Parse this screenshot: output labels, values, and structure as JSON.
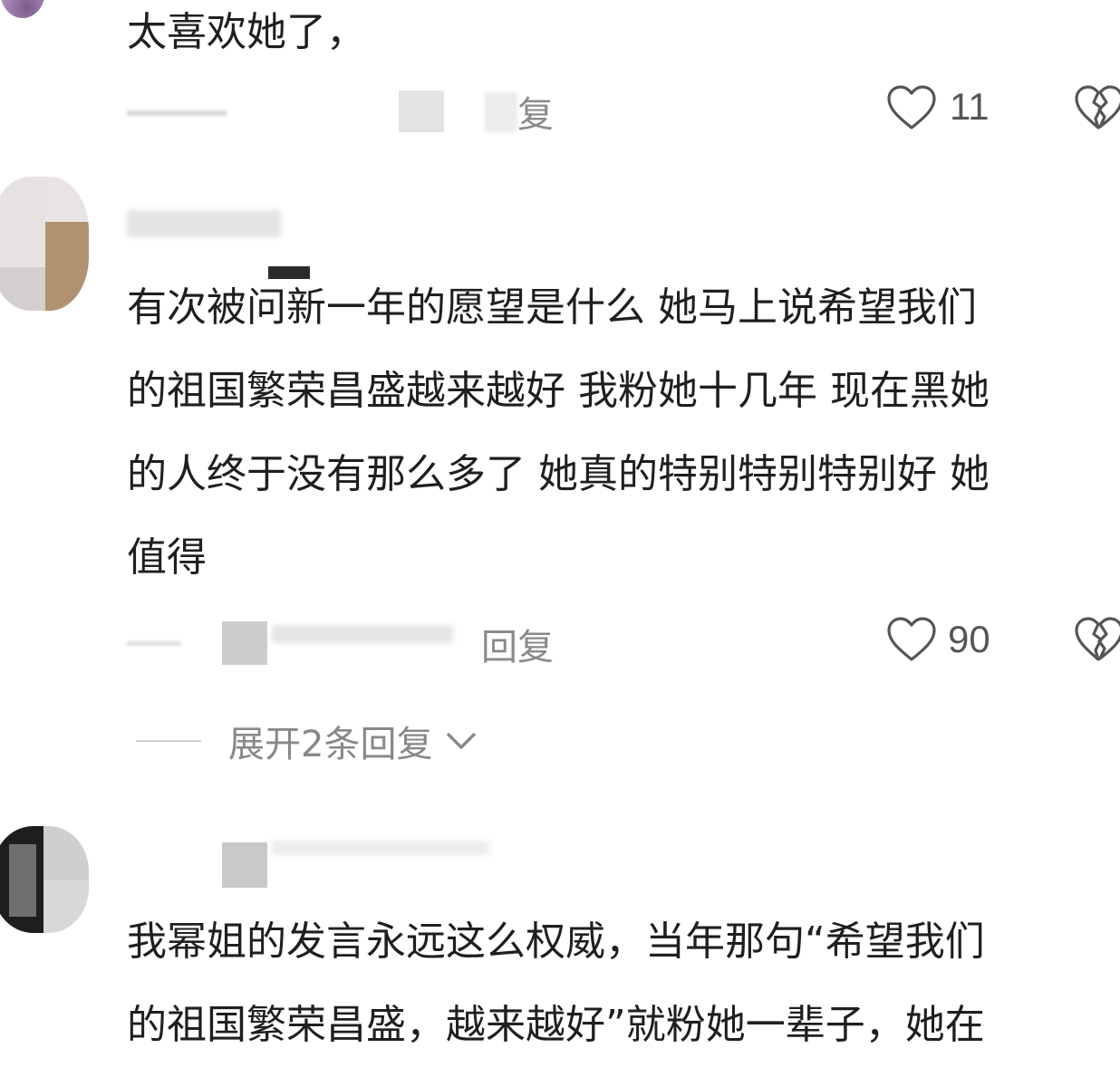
{
  "comments": [
    {
      "text_lines": [
        "太喜欢她了，"
      ],
      "reply_label": "复",
      "likes": "11"
    },
    {
      "text_lines": [
        "有次被问新一年的愿望是什么 她马上说希望我们",
        "的祖国繁荣昌盛越来越好 我粉她十几年 现在黑她",
        "的人终于没有那么多了 她真的特别特别特别好 她",
        "值得"
      ],
      "reply_label": "回复",
      "likes": "90",
      "expand_label": "展开2条回复"
    },
    {
      "text_lines": [
        "我幂姐的发言永远这么权威，当年那句“希望我们",
        "的祖国繁荣昌盛，越来越好”就粉她一辈子，她在"
      ]
    }
  ],
  "icons": {
    "like": "heart-outline-icon",
    "dislike": "broken-heart-icon",
    "expand": "chevron-down-icon"
  },
  "colors": {
    "text": "#1f1f1f",
    "muted": "#888888",
    "icon": "#555555"
  }
}
